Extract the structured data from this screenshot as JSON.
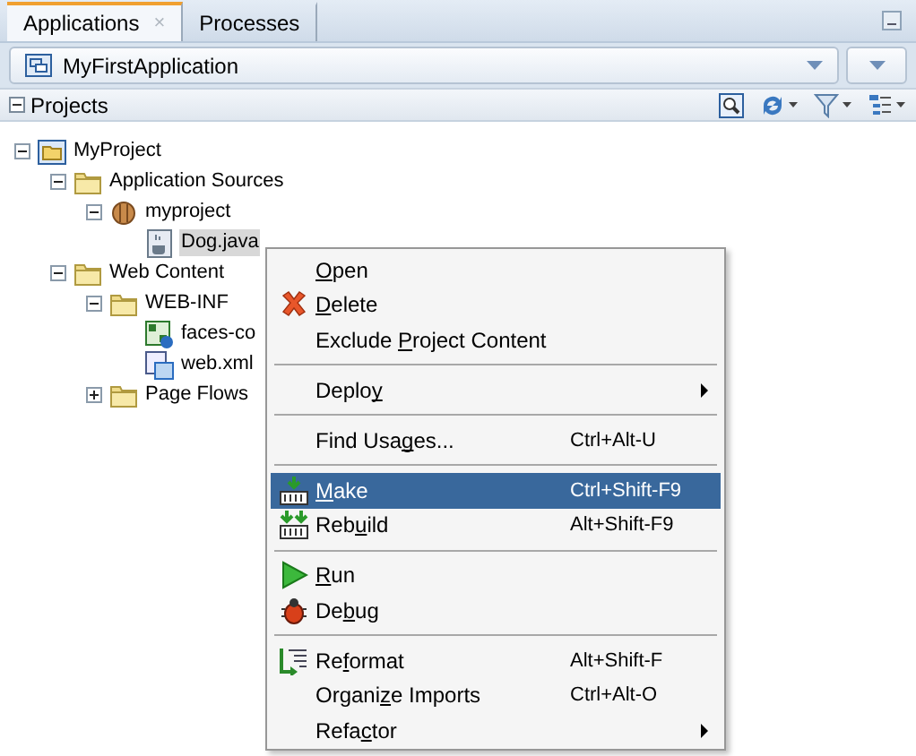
{
  "tabs": [
    {
      "label": "Applications",
      "selected": true,
      "close": "×"
    },
    {
      "label": "Processes",
      "selected": false
    }
  ],
  "application_selector": {
    "value": "MyFirstApplication"
  },
  "projects_panel": {
    "title": "Projects",
    "expanded": true
  },
  "tree": [
    {
      "label": "MyProject",
      "kind": "project",
      "expanded": true,
      "selected": false,
      "children": [
        {
          "label": "Application Sources",
          "kind": "folder",
          "expanded": true,
          "selected": false,
          "children": [
            {
              "label": "myproject",
              "kind": "package",
              "expanded": true,
              "selected": false,
              "children": [
                {
                  "label": "Dog.java",
                  "kind": "java",
                  "selected": true
                }
              ]
            }
          ]
        },
        {
          "label": "Web Content",
          "kind": "folder",
          "expanded": true,
          "selected": false,
          "children": [
            {
              "label": "WEB-INF",
              "kind": "folder",
              "expanded": true,
              "selected": false,
              "children": [
                {
                  "label": "faces-co",
                  "kind": "faces",
                  "selected": false
                },
                {
                  "label": "web.xml",
                  "kind": "xml",
                  "selected": false
                }
              ]
            },
            {
              "label": "Page Flows",
              "kind": "folder",
              "expanded": false,
              "selected": false
            }
          ]
        }
      ]
    }
  ],
  "context_menu": [
    {
      "kind": "item",
      "label_parts": [
        {
          "text": "O",
          "underlined": true
        },
        {
          "text": "pen",
          "underlined": false
        }
      ],
      "selected": false
    },
    {
      "kind": "item",
      "label_parts": [
        {
          "text": "D",
          "underlined": true
        },
        {
          "text": "elete",
          "underlined": false
        }
      ],
      "selected": false
    },
    {
      "kind": "item",
      "label_parts": [
        {
          "text": "Exclude ",
          "underlined": false
        },
        {
          "text": "P",
          "underlined": true
        },
        {
          "text": "roject Content",
          "underlined": false
        }
      ],
      "selected": false
    },
    {
      "kind": "separator"
    },
    {
      "kind": "item",
      "label_parts": [
        {
          "text": "Deplo",
          "underlined": false
        },
        {
          "text": "y",
          "underlined": true
        }
      ],
      "selected": false,
      "submenu": true
    },
    {
      "kind": "separator"
    },
    {
      "kind": "item",
      "label_parts": [
        {
          "text": "Find Usa",
          "underlined": false
        },
        {
          "text": "g",
          "underlined": true
        },
        {
          "text": "es...",
          "underlined": false
        }
      ],
      "shortcut": "Ctrl+Alt-U",
      "selected": false
    },
    {
      "kind": "separator"
    },
    {
      "kind": "item",
      "label_parts": [
        {
          "text": "M",
          "underlined": true
        },
        {
          "text": "ake",
          "underlined": false
        }
      ],
      "shortcut": "Ctrl+Shift-F9",
      "selected": true
    },
    {
      "kind": "item",
      "label_parts": [
        {
          "text": "Reb",
          "underlined": false
        },
        {
          "text": "u",
          "underlined": true
        },
        {
          "text": "ild",
          "underlined": false
        }
      ],
      "shortcut": "Alt+Shift-F9",
      "selected": false
    },
    {
      "kind": "separator"
    },
    {
      "kind": "item",
      "label_parts": [
        {
          "text": "R",
          "underlined": true
        },
        {
          "text": "un",
          "underlined": false
        }
      ],
      "selected": false
    },
    {
      "kind": "item",
      "label_parts": [
        {
          "text": "De",
          "underlined": false
        },
        {
          "text": "b",
          "underlined": true
        },
        {
          "text": "ug",
          "underlined": false
        }
      ],
      "selected": false
    },
    {
      "kind": "separator"
    },
    {
      "kind": "item",
      "label_parts": [
        {
          "text": "Re",
          "underlined": false
        },
        {
          "text": "f",
          "underlined": true
        },
        {
          "text": "ormat",
          "underlined": false
        }
      ],
      "shortcut": "Alt+Shift-F",
      "selected": false
    },
    {
      "kind": "item",
      "label_parts": [
        {
          "text": "Organi",
          "underlined": false
        },
        {
          "text": "z",
          "underlined": true
        },
        {
          "text": "e Imports",
          "underlined": false
        }
      ],
      "shortcut": "Ctrl+Alt-O",
      "selected": false
    },
    {
      "kind": "item",
      "label_parts": [
        {
          "text": "Refa",
          "underlined": false
        },
        {
          "text": "c",
          "underlined": true
        },
        {
          "text": "tor",
          "underlined": false
        }
      ],
      "selected": false,
      "submenu": true
    }
  ]
}
